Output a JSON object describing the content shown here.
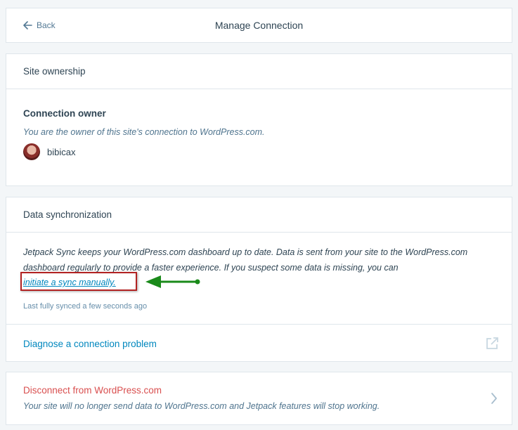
{
  "header": {
    "back_label": "Back",
    "title": "Manage Connection"
  },
  "ownership": {
    "section_title": "Site ownership",
    "owner_heading": "Connection owner",
    "owner_description": "You are the owner of this site's connection to WordPress.com.",
    "username": "bibicax"
  },
  "sync": {
    "section_title": "Data synchronization",
    "description": "Jetpack Sync keeps your WordPress.com dashboard up to date. Data is sent from your site to the WordPress.com dashboard regularly to provide a faster experience. If you suspect some data is missing, you can",
    "link_text": "initiate a sync manually.",
    "last_synced": "Last fully synced a few seconds ago",
    "diagnose_label": "Diagnose a connection problem"
  },
  "disconnect": {
    "title": "Disconnect from WordPress.com",
    "description": "Your site will no longer send data to WordPress.com and Jetpack features will stop working."
  },
  "icons": {
    "back": "arrow-left-icon",
    "external": "external-link-icon",
    "chevron": "chevron-right-icon"
  },
  "colors": {
    "link": "#0087be",
    "danger": "#d94f4f",
    "annotation_box": "#b22222",
    "annotation_arrow": "#1a8a1a"
  }
}
